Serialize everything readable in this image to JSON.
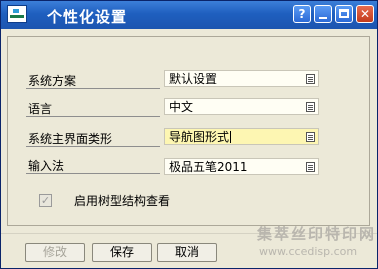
{
  "window": {
    "title": "个性化设置",
    "controls": [
      "?",
      "minimize",
      "maximize",
      "close"
    ]
  },
  "form": {
    "rows": [
      {
        "label": "系统方案",
        "value": "默认设置",
        "active": false
      },
      {
        "label": "语言",
        "value": "中文",
        "active": false
      },
      {
        "label": "系统主界面类形",
        "value": "导航图形式",
        "active": true
      },
      {
        "label": "输入法",
        "value": "极品五笔2011",
        "active": false
      }
    ],
    "checkbox": {
      "label": "启用树型结构查看",
      "checked": true,
      "enabled": false
    }
  },
  "buttons": {
    "edit": "修改",
    "save": "保存",
    "cancel": "取消"
  },
  "watermark": {
    "line1": "集萃丝印特印网",
    "line2": "www.ccedisp.com"
  }
}
